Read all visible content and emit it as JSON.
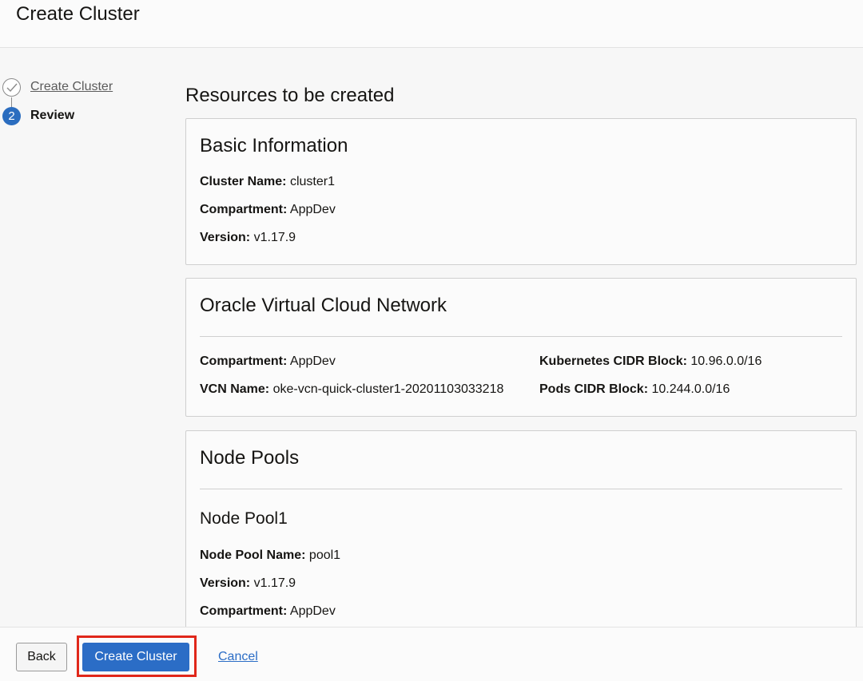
{
  "header": {
    "title": "Create Cluster"
  },
  "steps": [
    {
      "number": "",
      "label": "Create Cluster",
      "state": "completed",
      "icon": "check-icon"
    },
    {
      "number": "2",
      "label": "Review",
      "state": "current"
    }
  ],
  "main": {
    "title": "Resources to be created",
    "basic_info": {
      "title": "Basic Information",
      "fields": [
        {
          "key": "Cluster Name:",
          "value": "cluster1"
        },
        {
          "key": "Compartment:",
          "value": "AppDev"
        },
        {
          "key": "Version:",
          "value": "v1.17.9"
        }
      ]
    },
    "vcn": {
      "title": "Oracle Virtual Cloud Network",
      "left_fields": [
        {
          "key": "Compartment:",
          "value": "AppDev"
        },
        {
          "key": "VCN Name:",
          "value": "oke-vcn-quick-cluster1-20201103033218"
        }
      ],
      "right_fields": [
        {
          "key": "Kubernetes CIDR Block:",
          "value": "10.96.0.0/16"
        },
        {
          "key": "Pods CIDR Block:",
          "value": "10.244.0.0/16"
        }
      ]
    },
    "node_pools": {
      "title": "Node Pools",
      "pool_title": "Node Pool1",
      "fields": [
        {
          "key": "Node Pool Name:",
          "value": "pool1"
        },
        {
          "key": "Version:",
          "value": "v1.17.9"
        },
        {
          "key": "Compartment:",
          "value": "AppDev"
        }
      ]
    }
  },
  "footer": {
    "back_label": "Back",
    "create_label": "Create Cluster",
    "cancel_label": "Cancel"
  },
  "colors": {
    "primary": "#2b6dc6",
    "highlight": "#e0271a"
  }
}
